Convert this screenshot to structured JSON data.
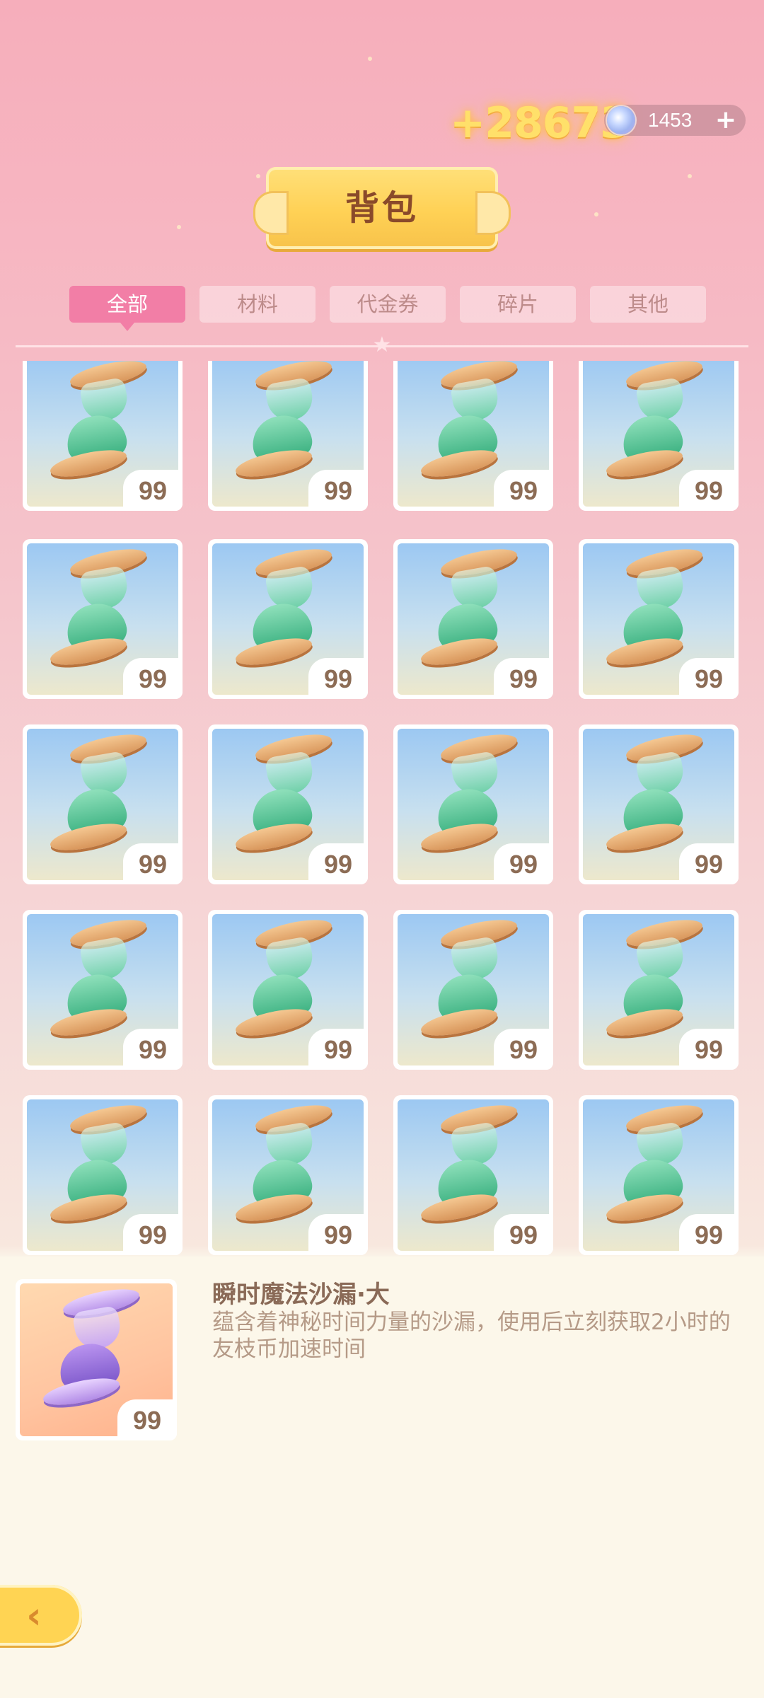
{
  "currency": {
    "gold": "+28673",
    "gems": "1453",
    "gem_plus": "+"
  },
  "header": {
    "title": "背包"
  },
  "tabs": [
    {
      "label": "全部",
      "active": true
    },
    {
      "label": "材料",
      "active": false
    },
    {
      "label": "代金券",
      "active": false
    },
    {
      "label": "碎片",
      "active": false
    },
    {
      "label": "其他",
      "active": false
    }
  ],
  "grid": {
    "items": [
      {
        "qty": "99",
        "icon": "green-hourglass-icon"
      },
      {
        "qty": "99",
        "icon": "green-hourglass-icon"
      },
      {
        "qty": "99",
        "icon": "green-hourglass-icon"
      },
      {
        "qty": "99",
        "icon": "green-hourglass-icon"
      },
      {
        "qty": "99",
        "icon": "green-hourglass-icon"
      },
      {
        "qty": "99",
        "icon": "green-hourglass-icon"
      },
      {
        "qty": "99",
        "icon": "green-hourglass-icon"
      },
      {
        "qty": "99",
        "icon": "green-hourglass-icon"
      },
      {
        "qty": "99",
        "icon": "green-hourglass-icon"
      },
      {
        "qty": "99",
        "icon": "green-hourglass-icon"
      },
      {
        "qty": "99",
        "icon": "green-hourglass-icon"
      },
      {
        "qty": "99",
        "icon": "green-hourglass-icon"
      },
      {
        "qty": "99",
        "icon": "green-hourglass-icon"
      },
      {
        "qty": "99",
        "icon": "green-hourglass-icon"
      },
      {
        "qty": "99",
        "icon": "green-hourglass-icon"
      },
      {
        "qty": "99",
        "icon": "green-hourglass-icon"
      },
      {
        "qty": "99",
        "icon": "green-hourglass-icon"
      },
      {
        "qty": "99",
        "icon": "green-hourglass-icon"
      },
      {
        "qty": "99",
        "icon": "green-hourglass-icon"
      },
      {
        "qty": "99",
        "icon": "green-hourglass-icon"
      }
    ]
  },
  "detail": {
    "name": "瞬时魔法沙漏·大",
    "description": "蕴含着神秘时间力量的沙漏，使用后立刻获取2小时的友枝币加速时间",
    "qty": "99",
    "icon": "purple-hourglass-icon"
  },
  "colors": {
    "accent": "#f27ea6",
    "gold": "#ffd453",
    "panel": "#fcf7ea"
  }
}
